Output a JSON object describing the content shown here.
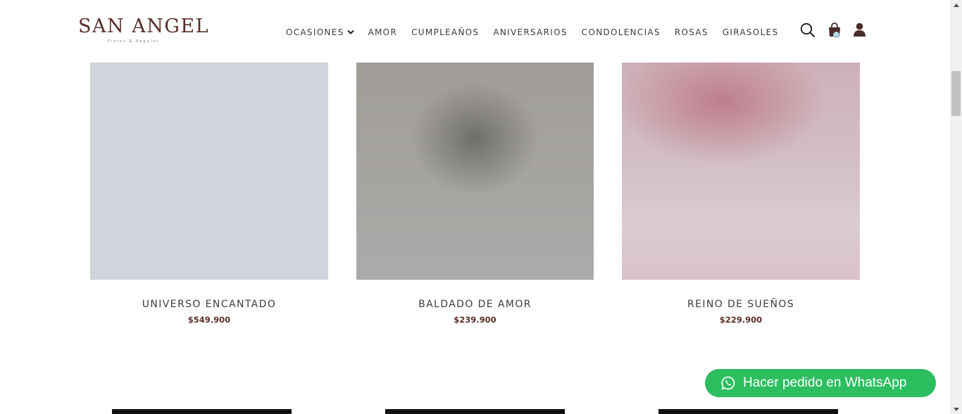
{
  "brand": {
    "name": "SAN ANGEL",
    "tagline": "Flores & Regalos"
  },
  "nav": {
    "items": [
      "OCASIONES",
      "AMOR",
      "CUMPLEAÑOS",
      "ANIVERSARIOS",
      "CONDOLENCIAS",
      "ROSAS",
      "GIRASOLES"
    ],
    "dropdown_item": "OCASIONES",
    "icons": [
      "search-icon",
      "shopping-bag-icon",
      "user-icon"
    ],
    "cart_count": "0"
  },
  "products": [
    {
      "name": "UNIVERSO ENCANTADO",
      "price": "$549.900"
    },
    {
      "name": "BALDADO DE AMOR",
      "price": "$239.900"
    },
    {
      "name": "REINO DE SUEÑOS",
      "price": "$229.900"
    }
  ],
  "whatsapp": {
    "label": "Hacer pedido en WhatsApp",
    "color": "#2dbe60",
    "icon": "whatsapp-icon"
  },
  "colors": {
    "brand": "#5a2f2c",
    "text": "#3d3d3d"
  }
}
